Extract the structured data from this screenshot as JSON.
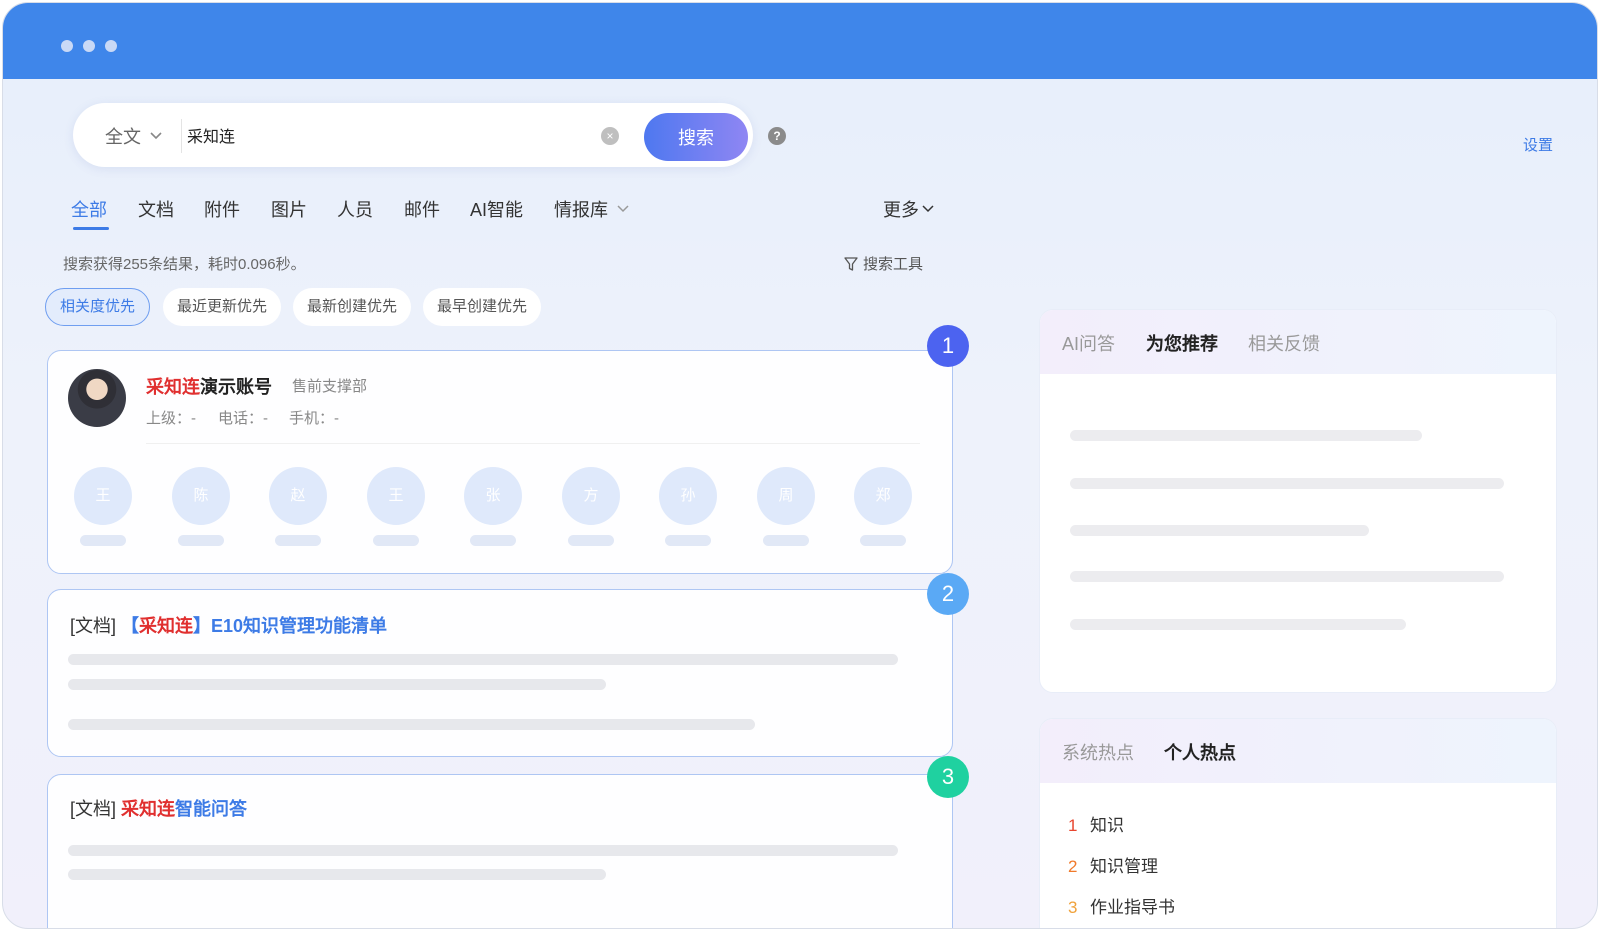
{
  "search": {
    "scope_label": "全文",
    "query": "采知连",
    "placeholder": "",
    "submit_label": "搜索",
    "help_icon_glyph": "?",
    "clear_icon_glyph": "×"
  },
  "header": {
    "settings_label": "设置"
  },
  "tabs": [
    {
      "label": "全部",
      "active": true
    },
    {
      "label": "文档"
    },
    {
      "label": "附件"
    },
    {
      "label": "图片"
    },
    {
      "label": "人员"
    },
    {
      "label": "邮件"
    },
    {
      "label": "AI智能"
    },
    {
      "label": "情报库"
    }
  ],
  "more_tab_label": "更多",
  "results_summary": "搜索获得255条结果，耗时0.096秒。",
  "search_tools_label": "搜索工具",
  "sort_options": [
    {
      "label": "相关度优先",
      "active": true
    },
    {
      "label": "最近更新优先"
    },
    {
      "label": "最新创建优先"
    },
    {
      "label": "最早创建优先"
    }
  ],
  "results": [
    {
      "rank": "1",
      "type": "person",
      "name_highlight": "采知连",
      "name_rest": "演示账号",
      "department": "售前支撑部",
      "meta": {
        "superior": "上级：-",
        "phone": "电话：-",
        "mobile": "手机：-"
      },
      "related_people": [
        "王",
        "陈",
        "赵",
        "王",
        "张",
        "方",
        "孙",
        "周",
        "郑"
      ]
    },
    {
      "rank": "2",
      "type": "document",
      "tag": "[文档]",
      "title_bracket_open": "【",
      "title_highlight": "采知连",
      "title_bracket_close": "】",
      "title_rest": "E10知识管理功能清单"
    },
    {
      "rank": "3",
      "type": "document",
      "tag": "[文档]",
      "title_highlight": "采知连",
      "title_rest": "智能问答"
    }
  ],
  "ai_panel": {
    "tabs": [
      {
        "label": "AI问答"
      },
      {
        "label": "为您推荐",
        "active": true
      },
      {
        "label": "相关反馈"
      }
    ]
  },
  "hot_panel": {
    "tabs": [
      {
        "label": "系统热点"
      },
      {
        "label": "个人热点",
        "active": true
      }
    ],
    "items": [
      {
        "rank": "1",
        "label": "知识"
      },
      {
        "rank": "2",
        "label": "知识管理"
      },
      {
        "rank": "3",
        "label": "作业指导书"
      }
    ]
  },
  "colors": {
    "titlebar": "#3f86ea",
    "accent": "#3d7be6",
    "highlight": "#e02f2f",
    "badge_1": "#4c63f0",
    "badge_2": "#5aa9f5",
    "badge_3": "#1fd1a0",
    "rank_1": "#e8452f",
    "rank_2": "#f07a2b",
    "rank_3": "#f0a23b"
  },
  "icons": {
    "window_controls": "window-dots-icon",
    "dropdown": "chevron-down-icon",
    "clear": "clear-circle-icon",
    "help": "help-circle-icon",
    "filter": "filter-icon"
  }
}
